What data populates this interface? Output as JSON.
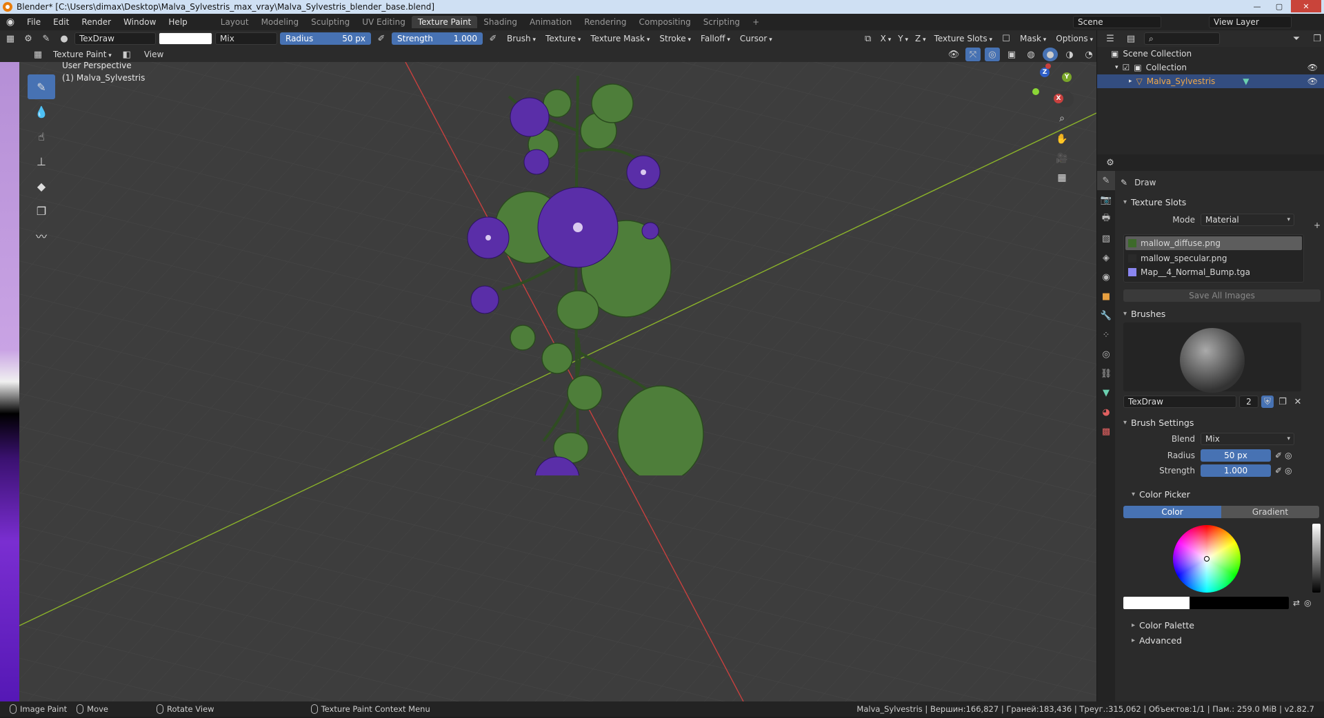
{
  "window": {
    "title": "Blender* [C:\\Users\\dimax\\Desktop\\Malva_Sylvestris_max_vray\\Malva_Sylvestris_blender_base.blend]",
    "minimize": "—",
    "maximize": "▢",
    "close": "✕"
  },
  "menu": [
    "File",
    "Edit",
    "Render",
    "Window",
    "Help"
  ],
  "workspaces": [
    "Layout",
    "Modeling",
    "Sculpting",
    "UV Editing",
    "Texture Paint",
    "Shading",
    "Animation",
    "Rendering",
    "Compositing",
    "Scripting"
  ],
  "active_workspace": "Texture Paint",
  "scene": {
    "name": "Scene",
    "view_layer": "View Layer"
  },
  "toolbar": {
    "brush_name": "TexDraw",
    "blend": "Mix",
    "radius_label": "Radius",
    "radius_value": "50 px",
    "strength_label": "Strength",
    "strength_value": "1.000",
    "brush": "Brush",
    "texture": "Texture",
    "texture_mask": "Texture Mask",
    "stroke": "Stroke",
    "falloff": "Falloff",
    "cursor": "Cursor",
    "x": "X",
    "y": "Y",
    "z": "Z",
    "texture_slots": "Texture Slots",
    "mask": "Mask",
    "options": "Options"
  },
  "header2": {
    "mode": "Texture Paint",
    "view": "View"
  },
  "viewport": {
    "perspective": "User Perspective",
    "object": "(1) Malva_Sylvestris"
  },
  "gizmo": {
    "z": "Z",
    "y": "Y",
    "x": "X"
  },
  "outliner": {
    "scene_collection": "Scene Collection",
    "collection": "Collection",
    "object": "Malva_Sylvestris"
  },
  "props": {
    "tool": "Draw",
    "texture_slots": {
      "title": "Texture Slots",
      "mode_label": "Mode",
      "mode": "Material",
      "slots": [
        "mallow_diffuse.png",
        "mallow_specular.png",
        "Map__4_Normal_Bump.tga"
      ],
      "save_all": "Save All Images"
    },
    "brushes": {
      "title": "Brushes",
      "name": "TexDraw",
      "users": "2"
    },
    "brush_settings": {
      "title": "Brush Settings",
      "blend_label": "Blend",
      "blend": "Mix",
      "radius_label": "Radius",
      "radius": "50 px",
      "strength_label": "Strength",
      "strength": "1.000"
    },
    "color_picker": {
      "title": "Color Picker",
      "color_tab": "Color",
      "gradient_tab": "Gradient"
    },
    "color_palette": "Color Palette",
    "advanced": "Advanced"
  },
  "status": {
    "image_paint": "Image Paint",
    "move": "Move",
    "rotate": "Rotate View",
    "context": "Texture Paint Context Menu",
    "stats": "Malva_Sylvestris | Вершин:166,827 | Граней:183,436 | Треуг.:315,062 | Объектов:1/1 | Пам.: 259.0 MiB | v2.82.7"
  },
  "colors": {
    "accent": "#4772b3",
    "selected_row": "#334d80",
    "x_axis": "#c8403e",
    "y_axis": "#8bb32a",
    "viewport_bg": "#3d3d3d"
  }
}
